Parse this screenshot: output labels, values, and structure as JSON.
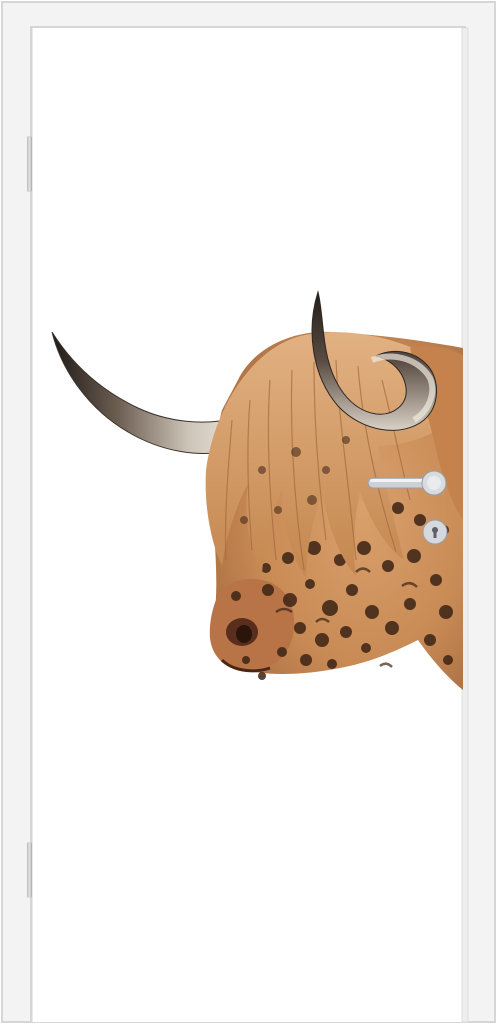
{
  "scene": {
    "subject_icon": "highland-cow-leopard-print-icon",
    "colors": {
      "frame": "#f4f4f4",
      "frame_shadow": "#dcdcdc",
      "panel": "#ffffff",
      "fur_light": "#e8b98a",
      "fur_mid": "#c98a55",
      "fur_dark": "#8a5430",
      "spots": "#3b2314",
      "horn_light": "#e9e3da",
      "horn_dark": "#2c2622",
      "handle_metal": "#c9ccd1"
    },
    "hardware": {
      "handle_icon": "door-handle-icon",
      "lock_icon": "keyhole-lock-icon",
      "hinge_icon": "door-hinge-icon"
    }
  }
}
